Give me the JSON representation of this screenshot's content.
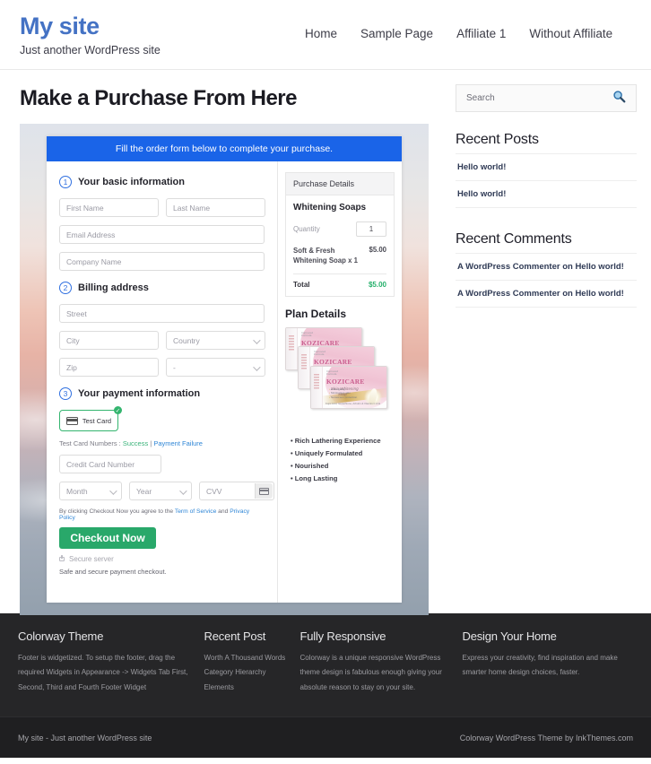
{
  "header": {
    "site_title": "My site",
    "tagline": "Just another WordPress site",
    "nav": [
      {
        "label": "Home"
      },
      {
        "label": "Sample Page"
      },
      {
        "label": "Affiliate 1"
      },
      {
        "label": "Without Affiliate"
      }
    ]
  },
  "main": {
    "page_title": "Make a Purchase From Here",
    "form": {
      "banner": "Fill the order form below to complete your purchase.",
      "step1": {
        "number": "1",
        "label": "Your basic information",
        "first_name_placeholder": "First Name",
        "last_name_placeholder": "Last Name",
        "email_placeholder": "Email Address",
        "company_placeholder": "Company Name"
      },
      "step2": {
        "number": "2",
        "label": "Billing address",
        "street_placeholder": "Street",
        "city_placeholder": "City",
        "country_value": "Country",
        "zip_placeholder": "Zip",
        "state_value": "-"
      },
      "step3": {
        "number": "3",
        "label": "Your payment information",
        "payment_method": "Test Card",
        "payment_selected_mark": "✓",
        "test_cards_label": "Test Card Numbers : ",
        "test_card_success": "Success",
        "test_card_divider": " | ",
        "test_card_failure": "Payment Failure",
        "card_number_placeholder": "Credit Card Number",
        "month_value": "Month",
        "year_value": "Year",
        "cvv_placeholder": "CVV",
        "terms_prefix": "By clicking Checkout Now you agree to the ",
        "terms_link": "Term of Service",
        "terms_mid": " and ",
        "privacy_link": "Privacy Policy",
        "checkout_button": "Checkout Now",
        "secure_server": "Secure server",
        "safe_note": "Safe and secure payment checkout."
      }
    },
    "purchase_details": {
      "heading": "Purchase Details",
      "product_name": "Whitening Soaps",
      "quantity_label": "Quantity",
      "quantity_value": "1",
      "line_item_name": "Soft & Fresh Whitening Soap x 1",
      "line_item_price": "$5.00",
      "total_label": "Total",
      "total_value": "$5.00",
      "total_color": "#25b06b"
    },
    "plan_details": {
      "heading": "Plan Details",
      "product_box": {
        "brand": "KOZICARE",
        "sub_line1": "Skin  Whitening",
        "sub_line2": "Soap",
        "top_note": "Improved\nFormula",
        "bullets": [
          "Anti-Ageing",
          "Moisturises skin",
          "Sunscreen protection"
        ],
        "ingredients": "Kojic Acid, Glutathione, Arbutin & Vitamin C & E"
      },
      "features": [
        "Rich Lathering Experience",
        "Uniquely Formulated",
        "Nourished",
        "Long Lasting"
      ]
    }
  },
  "sidebar": {
    "search": {
      "placeholder": "Search",
      "icon": "search-icon"
    },
    "recent_posts": {
      "title": "Recent Posts",
      "items": [
        "Hello world!",
        "Hello world!"
      ]
    },
    "recent_comments": {
      "title": "Recent Comments",
      "items": [
        "A WordPress Commenter on Hello world!",
        "A WordPress Commenter on Hello world!"
      ]
    }
  },
  "footer": {
    "columns": [
      {
        "title": "Colorway Theme",
        "text": "Footer is widgetized. To setup the footer, drag the required Widgets in Appearance -> Widgets Tab First, Second, Third and Fourth Footer Widget"
      },
      {
        "title": "Recent Post",
        "links": [
          "Worth A Thousand Words",
          "Category Hierarchy",
          "Elements"
        ]
      },
      {
        "title": "Fully Responsive",
        "text": "Colorway is a unique responsive WordPress theme design is fabulous enough giving your absolute reason to stay on your site."
      },
      {
        "title": "Design Your Home",
        "text": "Express your creativity, find inspiration and make smarter home design choices, faster."
      }
    ],
    "bottom_left": "My site - Just another WordPress site",
    "bottom_right": "Colorway WordPress Theme by InkThemes.com"
  }
}
